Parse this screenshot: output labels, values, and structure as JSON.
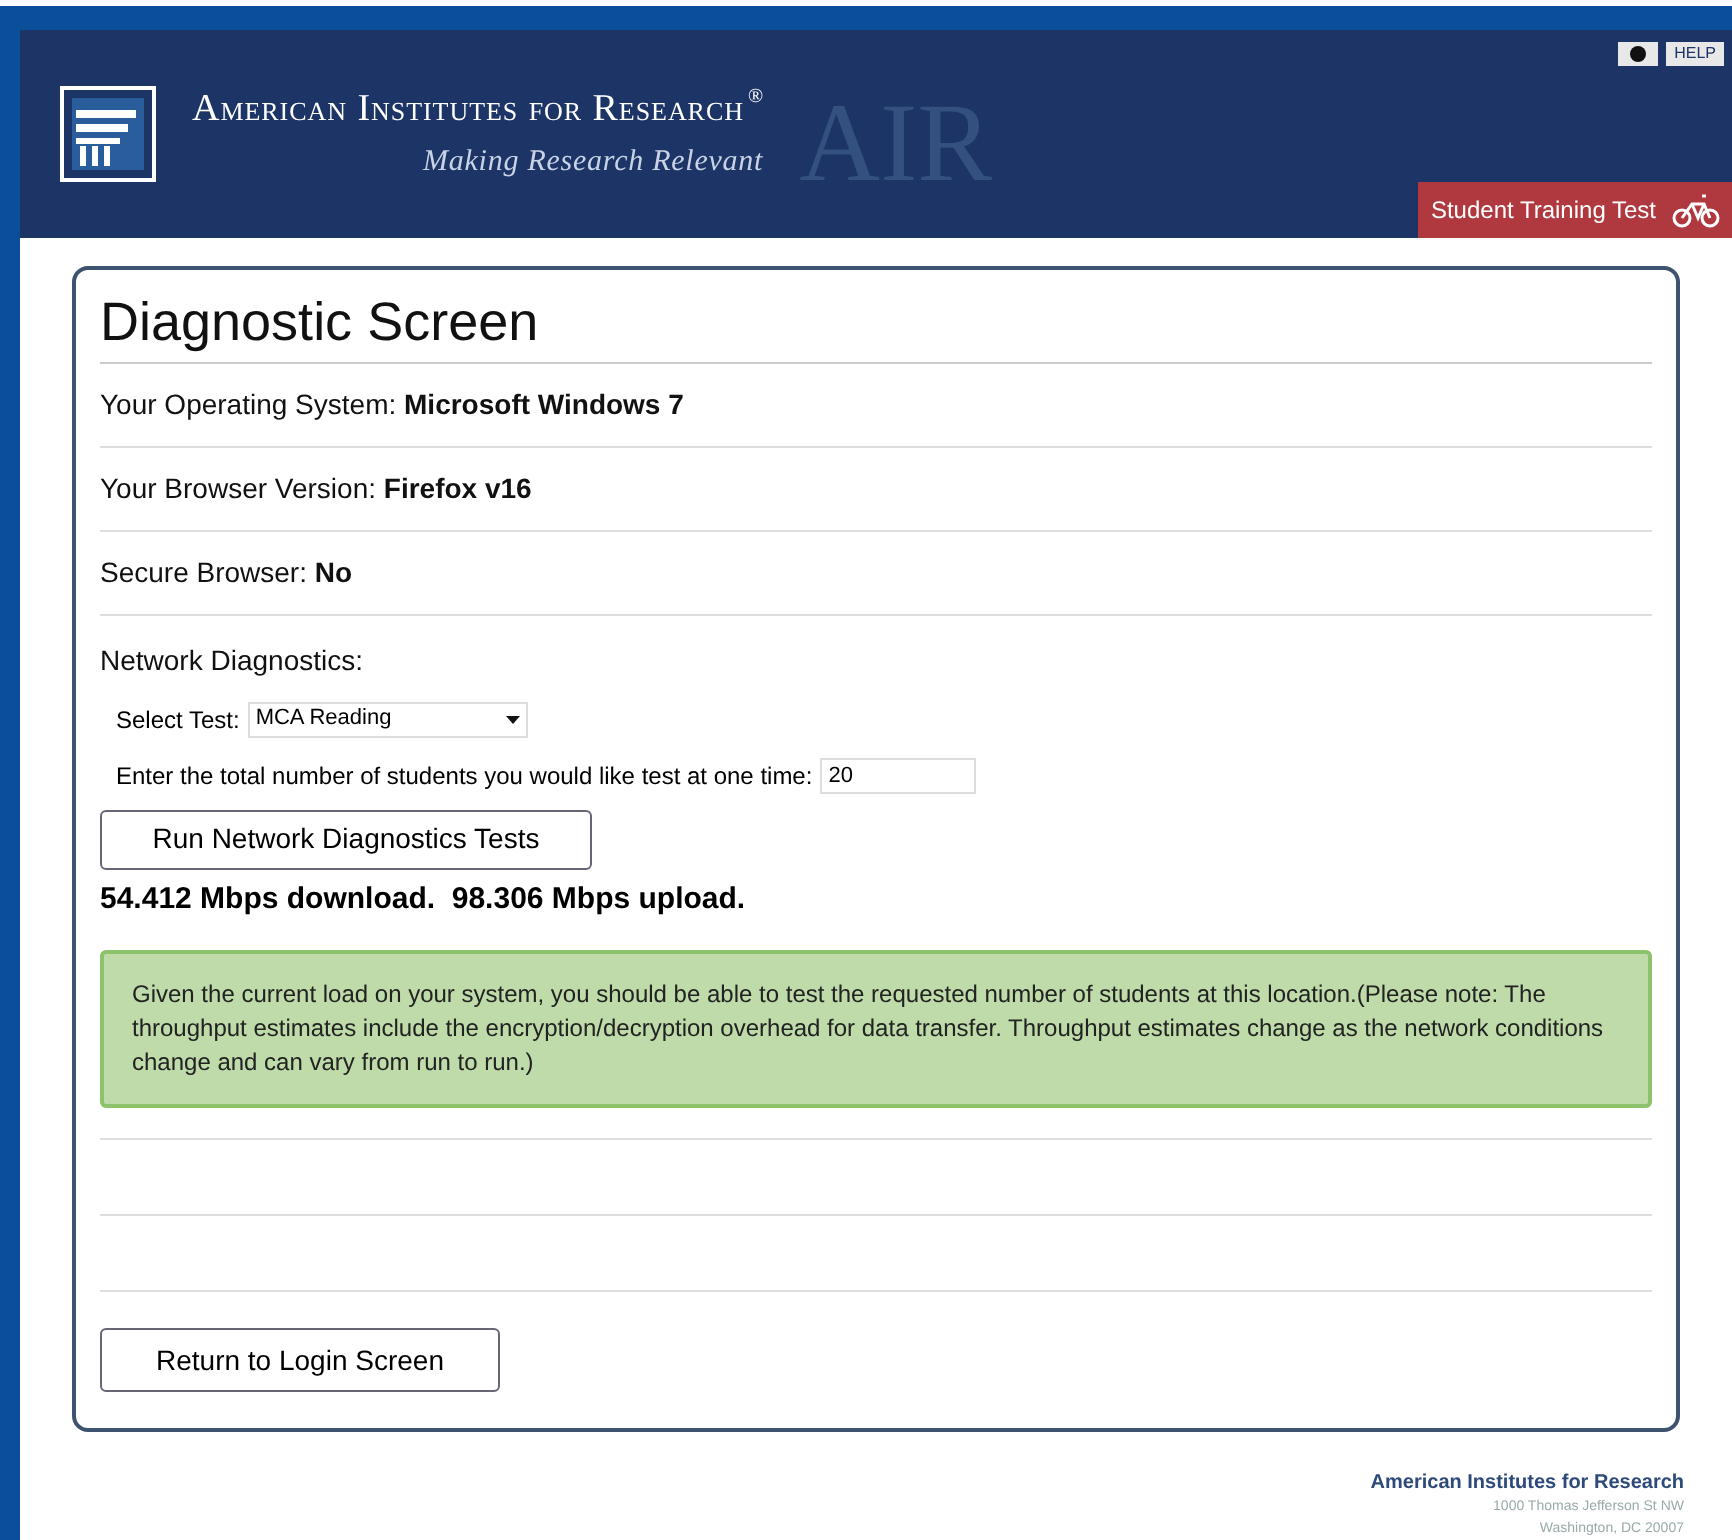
{
  "header": {
    "org_name": "American Institutes for Research",
    "registered_mark": "®",
    "tagline": "Making Research Relevant",
    "watermark": "AIR",
    "help_button": "HELP",
    "mode_badge": "Student Training Test"
  },
  "diagnostic": {
    "title": "Diagnostic Screen",
    "info_rows": [
      {
        "label": "Your Operating System:",
        "value": "Microsoft Windows 7"
      },
      {
        "label": "Your Browser Version:",
        "value": "Firefox v16"
      },
      {
        "label": "Secure Browser:",
        "value": "No"
      }
    ],
    "network_heading": "Network Diagnostics:",
    "select_label": "Select Test:",
    "select_value": "MCA Reading",
    "students_label": "Enter the total number of students you would like test at one time:",
    "students_value": "20",
    "run_button": "Run Network Diagnostics Tests",
    "result": "54.412 Mbps download.  98.306 Mbps upload.",
    "message": "Given the current load on your system, you should be able to test the requested number of students at this location.(Please note: The throughput estimates include the encryption/decryption overhead for data transfer. Throughput estimates change as the network conditions change and can vary from run to run.)",
    "return_button": "Return to Login Screen"
  },
  "footer": {
    "org_name": "American Institutes for Research",
    "address_line_1": "1000 Thomas Jefferson St NW",
    "address_line_2": "Washington, DC 20007"
  }
}
